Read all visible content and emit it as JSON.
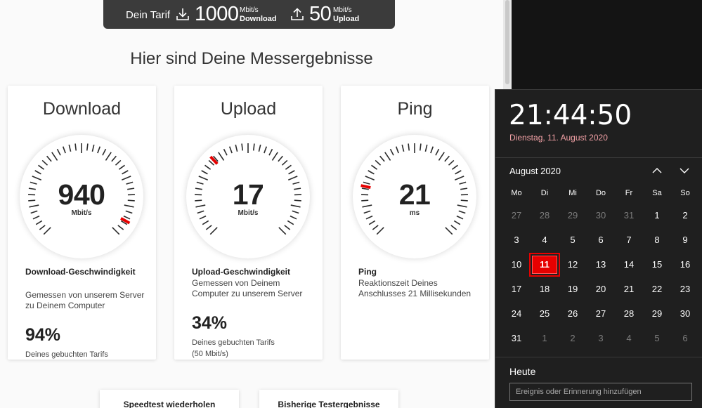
{
  "tariff": {
    "label": "Dein Tarif",
    "download_value": "1000",
    "download_unit": "Mbit/s",
    "download_label": "Download",
    "upload_value": "50",
    "upload_unit": "Mbit/s",
    "upload_label": "Upload"
  },
  "results_title": "Hier sind Deine Messergebnisse",
  "cards": [
    {
      "title": "Download",
      "value": "940",
      "unit": "Mbit/s",
      "gauge_fraction": 0.94,
      "heading": "Download-Geschwindigkeit",
      "desc": "Gemessen von unserem Server zu Deinem Computer",
      "percent": "94%",
      "percent_text": "Deines gebuchten Tarifs",
      "percent_sub": ""
    },
    {
      "title": "Upload",
      "value": "17",
      "unit": "Mbit/s",
      "gauge_fraction": 0.34,
      "heading": "Upload-Geschwindigkeit",
      "desc": "Gemessen von Deinem Computer zu unserem Server",
      "percent": "34%",
      "percent_text": "Deines gebuchten Tarifs",
      "percent_sub": "(50 Mbit/s)"
    },
    {
      "title": "Ping",
      "value": "21",
      "unit": "ms",
      "gauge_fraction": 0.21,
      "heading": "Ping",
      "desc": "Reaktionszeit Deines Anschlusses 21 Millisekunden",
      "percent": "",
      "percent_text": "",
      "percent_sub": ""
    }
  ],
  "buttons": {
    "repeat": "Speedtest wiederholen",
    "history": "Bisherige Testergebnisse"
  },
  "calendar": {
    "time": "21:44:50",
    "date_long": "Dienstag, 11. August 2020",
    "month_label": "August 2020",
    "weekdays": [
      "Mo",
      "Di",
      "Mi",
      "Do",
      "Fr",
      "Sa",
      "So"
    ],
    "weeks": [
      [
        {
          "d": "27",
          "m": true
        },
        {
          "d": "28",
          "m": true
        },
        {
          "d": "29",
          "m": true
        },
        {
          "d": "30",
          "m": true
        },
        {
          "d": "31",
          "m": true
        },
        {
          "d": "1"
        },
        {
          "d": "2"
        }
      ],
      [
        {
          "d": "3"
        },
        {
          "d": "4"
        },
        {
          "d": "5"
        },
        {
          "d": "6"
        },
        {
          "d": "7"
        },
        {
          "d": "8"
        },
        {
          "d": "9"
        }
      ],
      [
        {
          "d": "10"
        },
        {
          "d": "11",
          "today": true
        },
        {
          "d": "12"
        },
        {
          "d": "13"
        },
        {
          "d": "14"
        },
        {
          "d": "15"
        },
        {
          "d": "16"
        }
      ],
      [
        {
          "d": "17"
        },
        {
          "d": "18"
        },
        {
          "d": "19"
        },
        {
          "d": "20"
        },
        {
          "d": "21"
        },
        {
          "d": "22"
        },
        {
          "d": "23"
        }
      ],
      [
        {
          "d": "24"
        },
        {
          "d": "25"
        },
        {
          "d": "26"
        },
        {
          "d": "27"
        },
        {
          "d": "28"
        },
        {
          "d": "29"
        },
        {
          "d": "30"
        }
      ],
      [
        {
          "d": "31"
        },
        {
          "d": "1",
          "m": true
        },
        {
          "d": "2",
          "m": true
        },
        {
          "d": "3",
          "m": true
        },
        {
          "d": "4",
          "m": true
        },
        {
          "d": "5",
          "m": true
        },
        {
          "d": "6",
          "m": true
        }
      ]
    ],
    "today_heading": "Heute",
    "event_placeholder": "Ereignis oder Erinnerung hinzufügen"
  },
  "colors": {
    "accent_red": "#e60000",
    "date_pink": "#f2a1a6",
    "flyout_bg": "#1f1f1f",
    "tariff_bar": "#3b3b3b"
  }
}
